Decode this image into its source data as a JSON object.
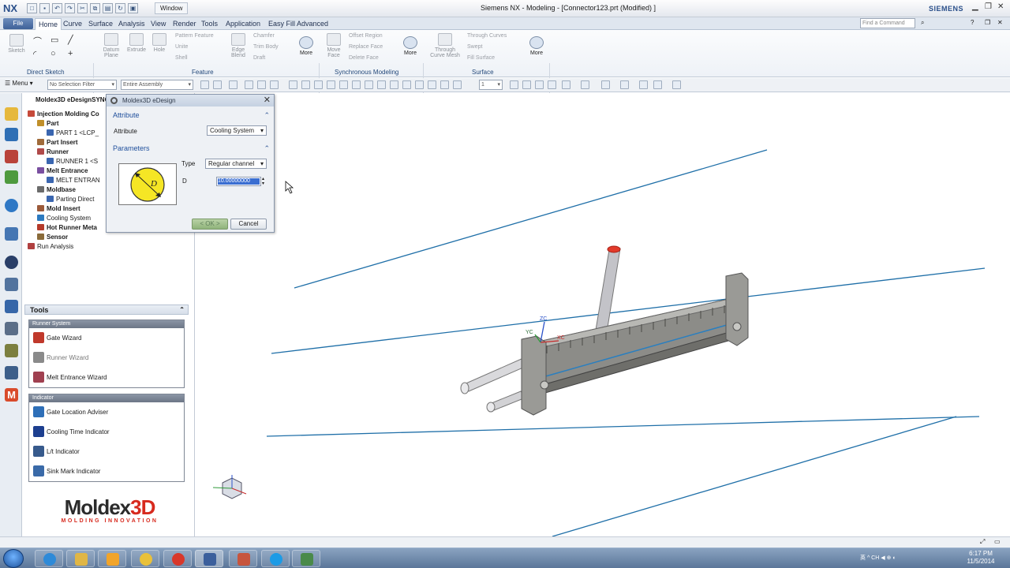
{
  "titlebar": {
    "logo": "NX",
    "window_menu": "Window",
    "title": "Siemens NX - Modeling - [Connector123.prt (Modified) ]",
    "brand": "SIEMENS"
  },
  "menubar": {
    "file": "File",
    "tabs": [
      "Home",
      "Curve",
      "Surface",
      "Analysis",
      "View",
      "Render",
      "Tools",
      "Application",
      "Easy Fill Advanced"
    ],
    "search_placeholder": "Find a Command"
  },
  "ribbon": {
    "direct_sketch": {
      "label": "Direct Sketch",
      "sketch": "Sketch"
    },
    "feature": {
      "label": "Feature",
      "datum_plane": "Datum Plane",
      "extrude": "Extrude",
      "hole": "Hole",
      "pattern_feature": "Pattern Feature",
      "unite": "Unite",
      "shell": "Shell",
      "edge_blend": "Edge Blend",
      "chamfer": "Chamfer",
      "trim_body": "Trim Body",
      "draft": "Draft",
      "more": "More"
    },
    "synchronous": {
      "label": "Synchronous Modeling",
      "move_face": "Move Face",
      "offset_region": "Offset Region",
      "replace_face": "Replace Face",
      "delete_face": "Delete Face",
      "more": "More"
    },
    "surface": {
      "label": "Surface",
      "through_curve_mesh": "Through Curve Mesh",
      "through_curves": "Through Curves",
      "swept": "Swept",
      "fill_surface": "Fill Surface",
      "more": "More"
    }
  },
  "selection_bar": {
    "menu": "Menu",
    "filter": "No Selection Filter",
    "scope": "Entire Assembly",
    "layer": "1"
  },
  "navigator": {
    "header": "Moldex3D eDesignSYNC",
    "items": [
      {
        "label": "Injection Molding Co",
        "indent": 0,
        "bold": true
      },
      {
        "label": "Part",
        "indent": 1,
        "bold": true
      },
      {
        "label": "PART 1 <LCP_",
        "indent": 2,
        "bold": false
      },
      {
        "label": "Part Insert",
        "indent": 1,
        "bold": true
      },
      {
        "label": "Runner",
        "indent": 1,
        "bold": true
      },
      {
        "label": "RUNNER 1 <S",
        "indent": 2,
        "bold": false
      },
      {
        "label": "Melt Entrance",
        "indent": 1,
        "bold": true
      },
      {
        "label": "MELT ENTRAN",
        "indent": 2,
        "bold": false
      },
      {
        "label": "Moldbase",
        "indent": 1,
        "bold": true
      },
      {
        "label": "Parting Direct",
        "indent": 2,
        "bold": false
      },
      {
        "label": "Mold Insert",
        "indent": 1,
        "bold": true
      },
      {
        "label": "Cooling System",
        "indent": 1,
        "bold": false
      },
      {
        "label": "Hot Runner Meta",
        "indent": 1,
        "bold": true
      },
      {
        "label": "Sensor",
        "indent": 1,
        "bold": true
      },
      {
        "label": "Run Analysis",
        "indent": 0,
        "bold": false
      }
    ]
  },
  "tools": {
    "header": "Tools",
    "runner_system": {
      "title": "Runner System",
      "items": [
        {
          "label": "Gate Wizard",
          "dim": false,
          "color": "#c0392b"
        },
        {
          "label": "Runner Wizard",
          "dim": true,
          "color": "#8a8a8a"
        },
        {
          "label": "Melt Entrance Wizard",
          "dim": false,
          "color": "#a04050"
        }
      ]
    },
    "indicator": {
      "title": "Indicator",
      "items": [
        {
          "label": "Gate Location Adviser",
          "dim": false,
          "color": "#2e6fb8"
        },
        {
          "label": "Cooling Time Indicator",
          "dim": false,
          "color": "#1d3f8f"
        },
        {
          "label": "L/t Indicator",
          "dim": false,
          "color": "#375a8c"
        },
        {
          "label": "Sink Mark Indicator",
          "dim": false,
          "color": "#3a6aa8"
        }
      ]
    }
  },
  "logo": {
    "main_a": "Moldex",
    "main_b": "3D",
    "sub": "MOLDING INNOVATION"
  },
  "dialog": {
    "title": "Moldex3D eDesign",
    "attribute_section": "Attribute",
    "attribute_label": "Attribute",
    "attribute_value": "Cooling System",
    "parameters_section": "Parameters",
    "type_label": "Type",
    "type_value": "Regular channel",
    "d_label": "D",
    "d_value": "10.00000000",
    "preview_letter": "D",
    "ok": "< OK >",
    "cancel": "Cancel"
  },
  "triad": {
    "zc": "ZC",
    "yc": "YC",
    "xc": "XC"
  },
  "taskbar": {
    "tray": "英 ^  CH  ◀  ⊕  ◐",
    "time": "6:17 PM",
    "date": "11/5/2014"
  },
  "colors": {
    "accent": "#3e6198",
    "channel": "#1f6fa8",
    "part": "#8b8b86",
    "gate": "#e23a2a"
  }
}
